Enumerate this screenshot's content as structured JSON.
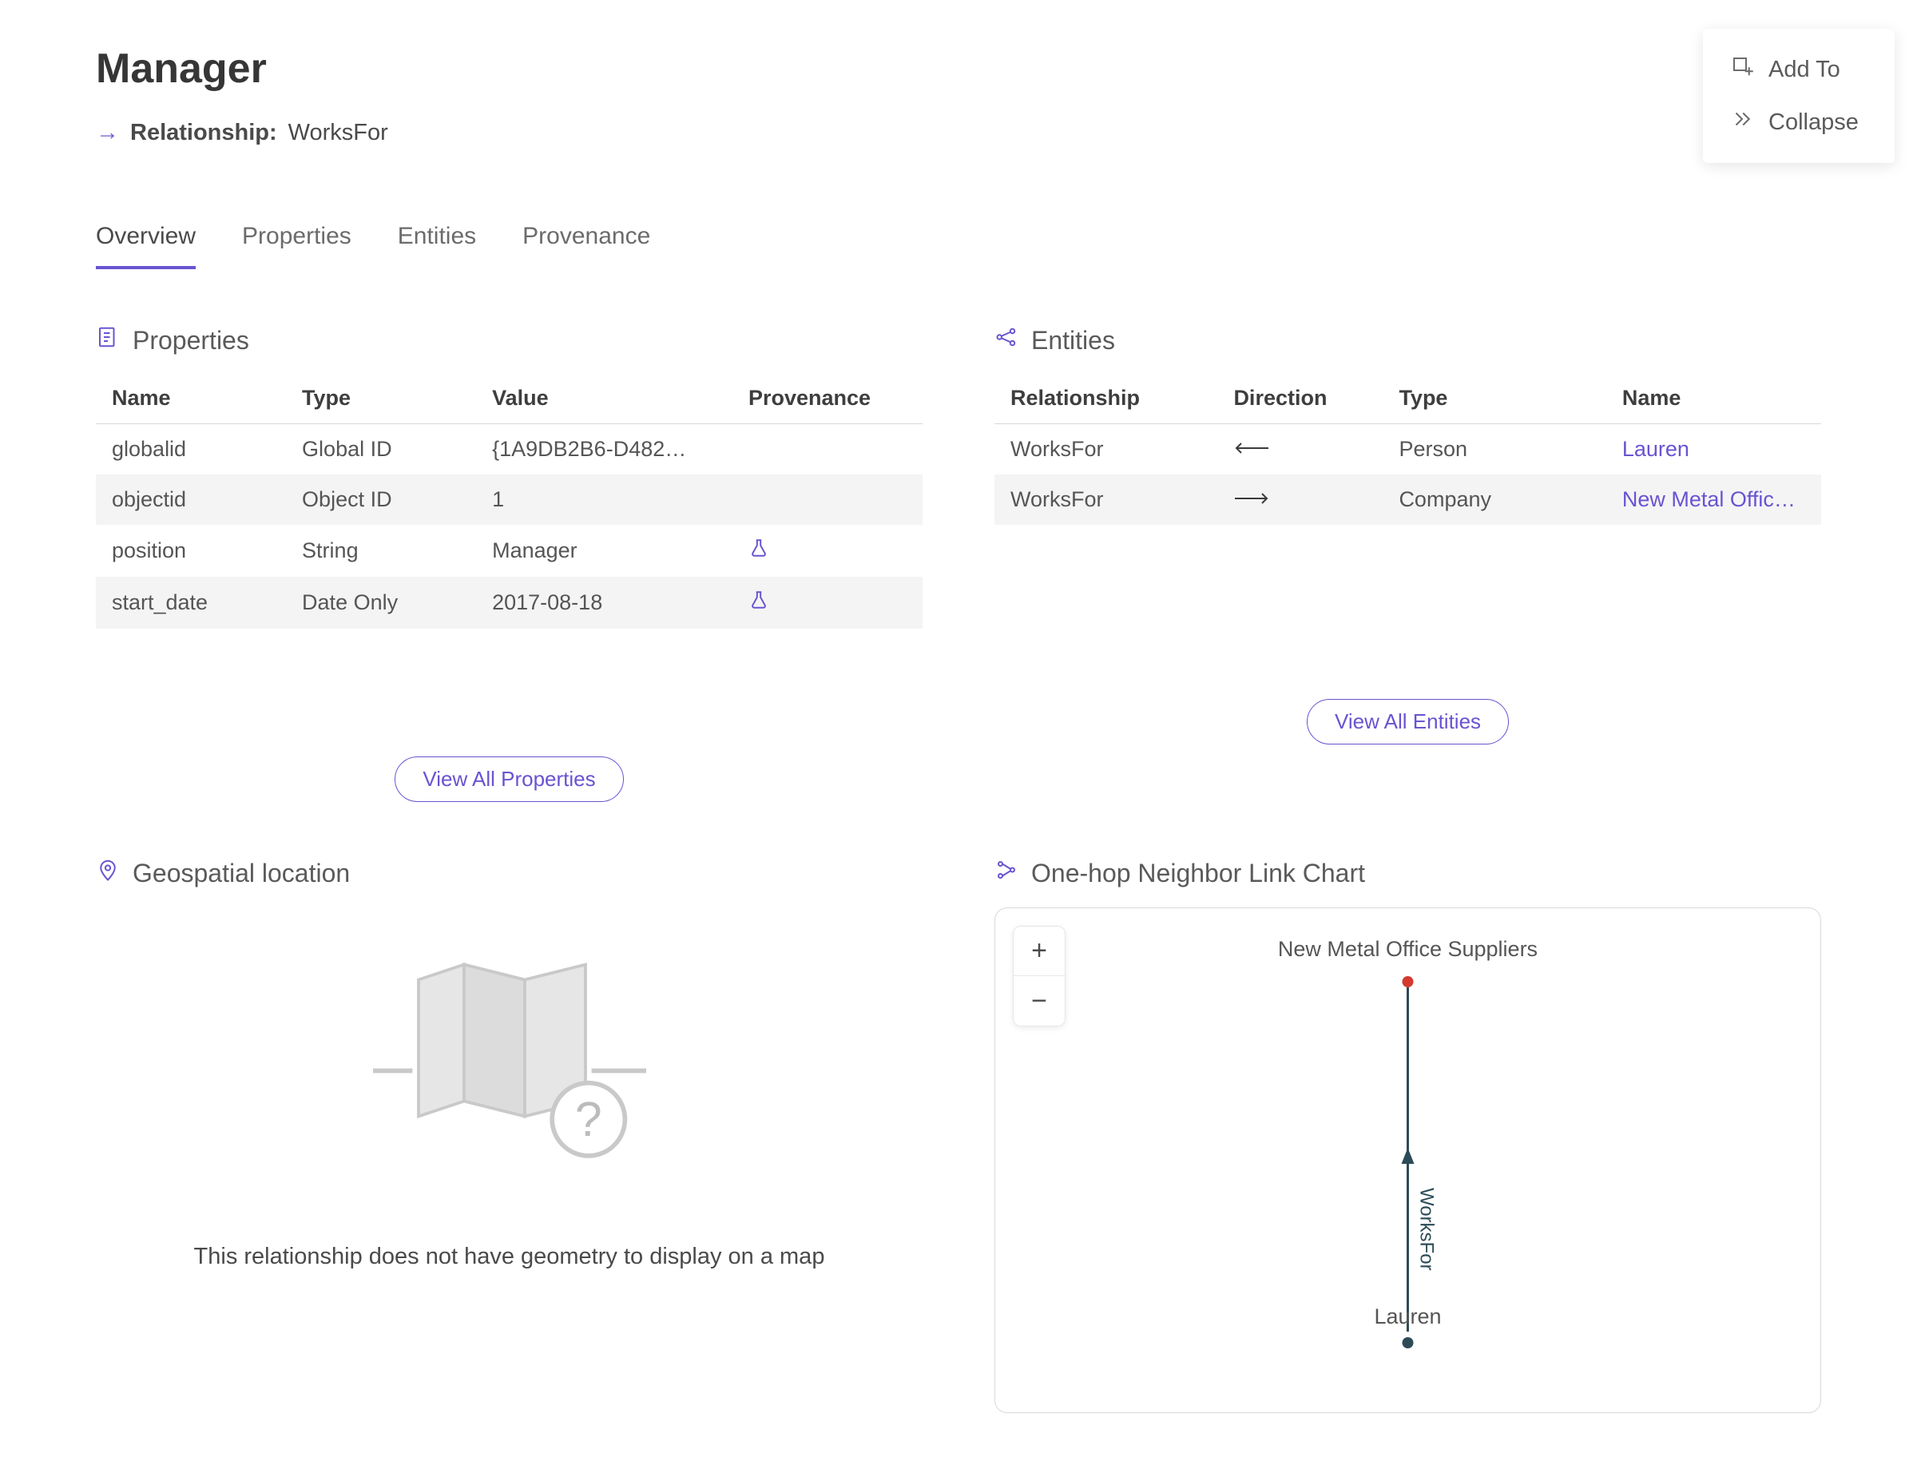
{
  "header": {
    "title": "Manager",
    "relationship_label": "Relationship:",
    "relationship_value": "WorksFor",
    "arrow": "→"
  },
  "top_actions": {
    "add_to": "Add To",
    "collapse": "Collapse"
  },
  "tabs": {
    "overview": "Overview",
    "properties": "Properties",
    "entities": "Entities",
    "provenance": "Provenance"
  },
  "sections": {
    "properties": "Properties",
    "entities": "Entities",
    "geospatial": "Geospatial location",
    "link_chart": "One-hop Neighbor Link Chart"
  },
  "properties_table": {
    "columns": {
      "name": "Name",
      "type": "Type",
      "value": "Value",
      "provenance": "Provenance"
    },
    "rows": [
      {
        "name": "globalid",
        "type": "Global ID",
        "value": "{1A9DB2B6-D482…",
        "has_provenance": false
      },
      {
        "name": "objectid",
        "type": "Object ID",
        "value": "1",
        "has_provenance": false
      },
      {
        "name": "position",
        "type": "String",
        "value": "Manager",
        "has_provenance": true
      },
      {
        "name": "start_date",
        "type": "Date Only",
        "value": "2017-08-18",
        "has_provenance": true
      }
    ]
  },
  "entities_table": {
    "columns": {
      "relationship": "Relationship",
      "direction": "Direction",
      "type": "Type",
      "name": "Name"
    },
    "rows": [
      {
        "relationship": "WorksFor",
        "direction": "left",
        "type": "Person",
        "name": "Lauren"
      },
      {
        "relationship": "WorksFor",
        "direction": "right",
        "type": "Company",
        "name": "New Metal Offic…"
      }
    ]
  },
  "buttons": {
    "view_all_properties": "View All Properties",
    "view_all_entities": "View All Entities"
  },
  "geospatial": {
    "empty_message": "This relationship does not have geometry to display on a map"
  },
  "link_chart": {
    "zoom_in": "+",
    "zoom_out": "−",
    "top_node": "New Metal Office Suppliers",
    "bottom_node": "Lauren",
    "edge_label": "WorksFor"
  }
}
